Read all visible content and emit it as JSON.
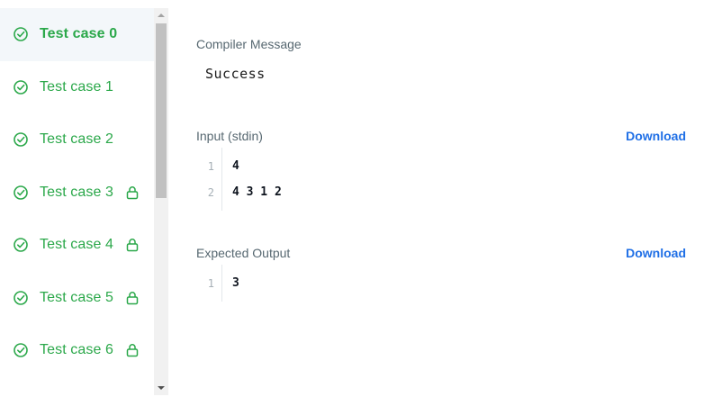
{
  "sidebar": {
    "items": [
      {
        "label": "Test case 0",
        "active": true,
        "locked": false
      },
      {
        "label": "Test case 1",
        "active": false,
        "locked": false
      },
      {
        "label": "Test case 2",
        "active": false,
        "locked": false
      },
      {
        "label": "Test case 3",
        "active": false,
        "locked": true
      },
      {
        "label": "Test case 4",
        "active": false,
        "locked": true
      },
      {
        "label": "Test case 5",
        "active": false,
        "locked": true
      },
      {
        "label": "Test case 6",
        "active": false,
        "locked": true
      }
    ]
  },
  "compiler": {
    "label": "Compiler Message",
    "message": "Success"
  },
  "input": {
    "label": "Input (stdin)",
    "download_label": "Download",
    "lines": [
      {
        "num": "1",
        "text": "4"
      },
      {
        "num": "2",
        "text": "4 3 1 2"
      }
    ]
  },
  "expected": {
    "label": "Expected Output",
    "download_label": "Download",
    "lines": [
      {
        "num": "1",
        "text": "3"
      }
    ]
  },
  "colors": {
    "success_green": "#2ba84a",
    "link_blue": "#1f6fe6",
    "label_gray": "#576871",
    "active_bg": "#f3f7fa"
  }
}
